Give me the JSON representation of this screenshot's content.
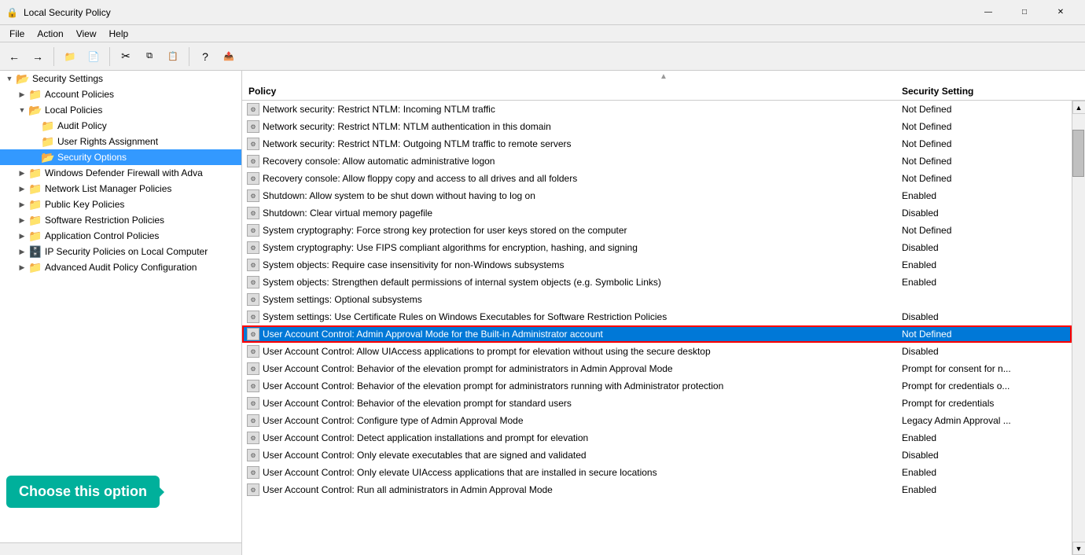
{
  "titleBar": {
    "title": "Local Security Policy",
    "icon": "🔒",
    "minimizeLabel": "—",
    "maximizeLabel": "□",
    "closeLabel": "✕"
  },
  "menuBar": {
    "items": [
      {
        "label": "File"
      },
      {
        "label": "Action"
      },
      {
        "label": "View"
      },
      {
        "label": "Help"
      }
    ]
  },
  "toolbar": {
    "buttons": [
      {
        "name": "back",
        "icon": "←"
      },
      {
        "name": "forward",
        "icon": "→"
      },
      {
        "name": "up",
        "icon": "📁"
      },
      {
        "name": "sep1",
        "type": "sep"
      },
      {
        "name": "cut",
        "icon": "✂"
      },
      {
        "name": "copy",
        "icon": "📋"
      },
      {
        "name": "paste",
        "icon": "📌"
      },
      {
        "name": "sep2",
        "type": "sep"
      },
      {
        "name": "help",
        "icon": "?"
      },
      {
        "name": "export",
        "icon": "📤"
      }
    ]
  },
  "treePanel": {
    "items": [
      {
        "id": "security-settings",
        "label": "Security Settings",
        "indent": 0,
        "expand": "▼",
        "icon": "folder-open",
        "selected": false
      },
      {
        "id": "account-policies",
        "label": "Account Policies",
        "indent": 1,
        "expand": "▶",
        "icon": "folder-closed",
        "selected": false
      },
      {
        "id": "local-policies",
        "label": "Local Policies",
        "indent": 1,
        "expand": "▼",
        "icon": "folder-open",
        "selected": false
      },
      {
        "id": "audit-policy",
        "label": "Audit Policy",
        "indent": 2,
        "expand": "",
        "icon": "folder-closed",
        "selected": false
      },
      {
        "id": "user-rights",
        "label": "User Rights Assignment",
        "indent": 2,
        "expand": "",
        "icon": "folder-closed",
        "selected": false
      },
      {
        "id": "security-options",
        "label": "Security Options",
        "indent": 2,
        "expand": "",
        "icon": "folder-open",
        "selected": true
      },
      {
        "id": "windows-defender",
        "label": "Windows Defender Firewall with Adva",
        "indent": 1,
        "expand": "▶",
        "icon": "folder-closed",
        "selected": false
      },
      {
        "id": "network-list",
        "label": "Network List Manager Policies",
        "indent": 1,
        "expand": "▶",
        "icon": "folder-closed",
        "selected": false
      },
      {
        "id": "public-key",
        "label": "Public Key Policies",
        "indent": 1,
        "expand": "▶",
        "icon": "folder-closed",
        "selected": false
      },
      {
        "id": "software-restriction",
        "label": "Software Restriction Policies",
        "indent": 1,
        "expand": "▶",
        "icon": "folder-closed",
        "selected": false
      },
      {
        "id": "app-control",
        "label": "Application Control Policies",
        "indent": 1,
        "expand": "▶",
        "icon": "folder-closed",
        "selected": false
      },
      {
        "id": "ip-security",
        "label": "IP Security Policies on Local Computer",
        "indent": 1,
        "expand": "▶",
        "icon": "folder-special",
        "selected": false
      },
      {
        "id": "advanced-audit",
        "label": "Advanced Audit Policy Configuration",
        "indent": 1,
        "expand": "▶",
        "icon": "folder-closed",
        "selected": false
      }
    ],
    "tooltip": "Choose this option"
  },
  "rightPanel": {
    "columns": {
      "policy": "Policy",
      "setting": "Security Setting"
    },
    "policies": [
      {
        "name": "Network security: Restrict NTLM: Incoming NTLM traffic",
        "value": "Not Defined",
        "selected": false
      },
      {
        "name": "Network security: Restrict NTLM: NTLM authentication in this domain",
        "value": "Not Defined",
        "selected": false
      },
      {
        "name": "Network security: Restrict NTLM: Outgoing NTLM traffic to remote servers",
        "value": "Not Defined",
        "selected": false
      },
      {
        "name": "Recovery console: Allow automatic administrative logon",
        "value": "Not Defined",
        "selected": false
      },
      {
        "name": "Recovery console: Allow floppy copy and access to all drives and all folders",
        "value": "Not Defined",
        "selected": false
      },
      {
        "name": "Shutdown: Allow system to be shut down without having to log on",
        "value": "Enabled",
        "selected": false
      },
      {
        "name": "Shutdown: Clear virtual memory pagefile",
        "value": "Disabled",
        "selected": false
      },
      {
        "name": "System cryptography: Force strong key protection for user keys stored on the computer",
        "value": "Not Defined",
        "selected": false
      },
      {
        "name": "System cryptography: Use FIPS compliant algorithms for encryption, hashing, and signing",
        "value": "Disabled",
        "selected": false
      },
      {
        "name": "System objects: Require case insensitivity for non-Windows subsystems",
        "value": "Enabled",
        "selected": false
      },
      {
        "name": "System objects: Strengthen default permissions of internal system objects (e.g. Symbolic Links)",
        "value": "Enabled",
        "selected": false
      },
      {
        "name": "System settings: Optional subsystems",
        "value": "",
        "selected": false
      },
      {
        "name": "System settings: Use Certificate Rules on Windows Executables for Software Restriction Policies",
        "value": "Disabled",
        "selected": false
      },
      {
        "name": "User Account Control: Admin Approval Mode for the Built-in Administrator account",
        "value": "Not Defined",
        "selected": true
      },
      {
        "name": "User Account Control: Allow UIAccess applications to prompt for elevation without using the secure desktop",
        "value": "Disabled",
        "selected": false
      },
      {
        "name": "User Account Control: Behavior of the elevation prompt for administrators in Admin Approval Mode",
        "value": "Prompt for consent for n...",
        "selected": false
      },
      {
        "name": "User Account Control: Behavior of the elevation prompt for administrators running with Administrator protection",
        "value": "Prompt for credentials o...",
        "selected": false
      },
      {
        "name": "User Account Control: Behavior of the elevation prompt for standard users",
        "value": "Prompt for credentials",
        "selected": false
      },
      {
        "name": "User Account Control: Configure type of Admin Approval Mode",
        "value": "Legacy Admin Approval ...",
        "selected": false
      },
      {
        "name": "User Account Control: Detect application installations and prompt for elevation",
        "value": "Enabled",
        "selected": false
      },
      {
        "name": "User Account Control: Only elevate executables that are signed and validated",
        "value": "Disabled",
        "selected": false
      },
      {
        "name": "User Account Control: Only elevate UIAccess applications that are installed in secure locations",
        "value": "Enabled",
        "selected": false
      },
      {
        "name": "User Account Control: Run all administrators in Admin Approval Mode",
        "value": "Enabled",
        "selected": false
      }
    ]
  }
}
